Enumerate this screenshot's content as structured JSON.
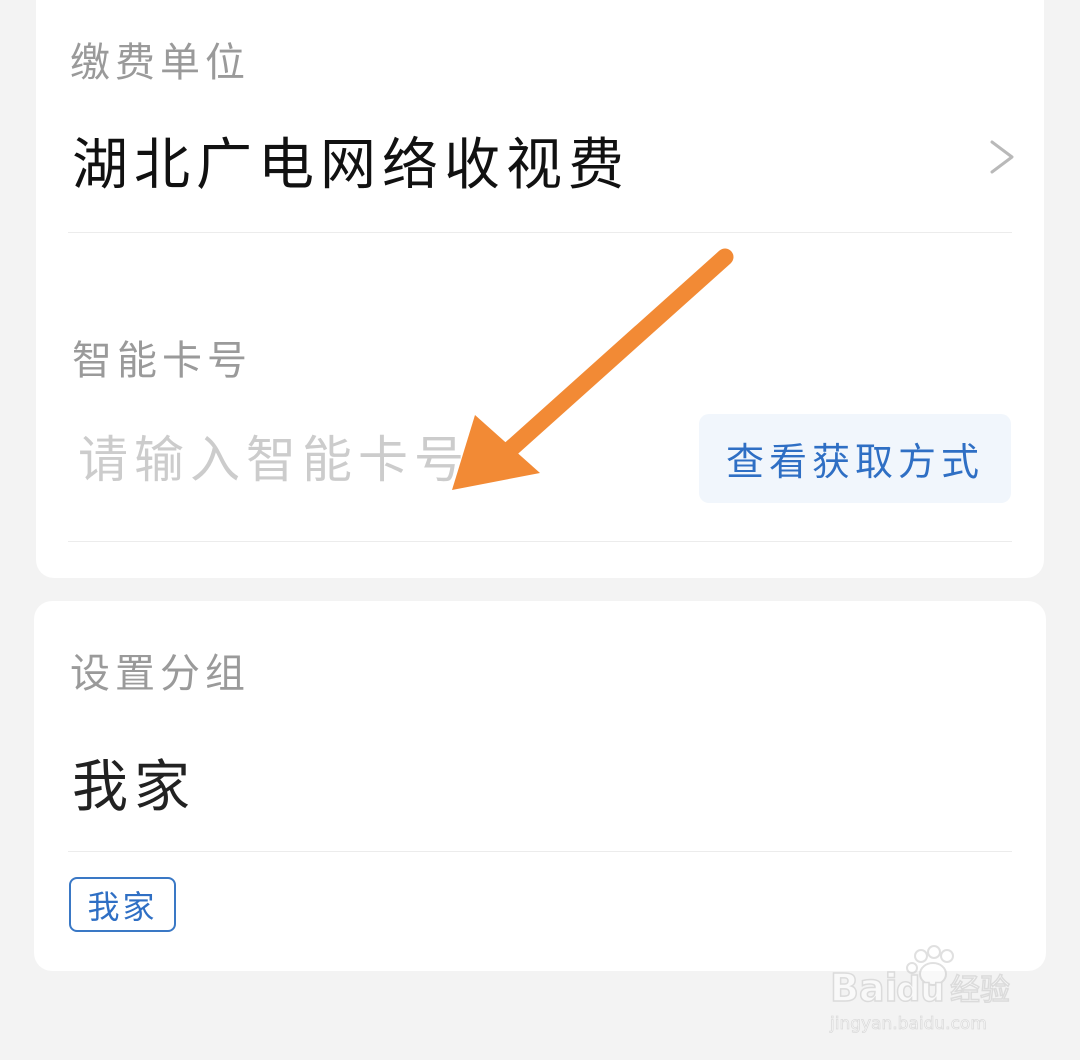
{
  "payment_unit": {
    "label": "缴费单位",
    "value": "湖北广电网络收视费"
  },
  "smart_card": {
    "label": "智能卡号",
    "placeholder": "请输入智能卡号",
    "howto_button": "查看获取方式"
  },
  "group": {
    "label": "设置分组",
    "value": "我家",
    "tags": [
      "我家"
    ]
  },
  "watermark": {
    "brand": "Baidu经验",
    "url": "jingyan.baidu.com"
  },
  "colors": {
    "accent": "#2f6fc4",
    "arrow": "#f28a35",
    "background": "#f3f3f3"
  },
  "icons": {
    "chevron": "chevron-right-icon",
    "arrow": "orange-pointer-arrow-icon"
  }
}
